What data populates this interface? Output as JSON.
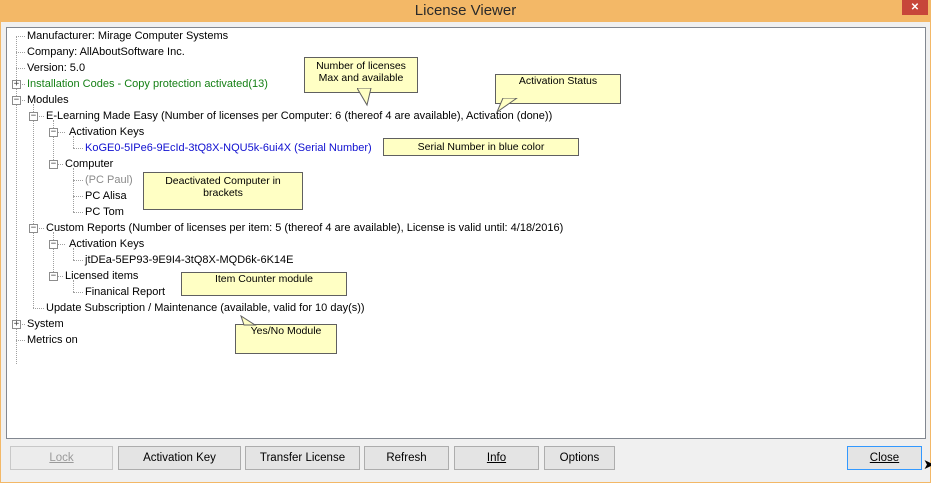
{
  "window": {
    "title": "License Viewer"
  },
  "tree": {
    "manufacturer": "Manufacturer: Mirage Computer Systems",
    "company": "Company: AllAboutSoftware Inc.",
    "version": "Version: 5.0",
    "installation_codes": "Installation Codes - Copy protection activated(13)",
    "modules": "Modules",
    "elearning": "E-Learning Made Easy (Number of licenses per Computer: 6 (thereof 4 are available), Activation (done))",
    "activation_keys_1": "Activation Keys",
    "serial_1": "KoGE0-5IPe6-9EcId-3tQ8X-NQU5k-6ui4X (Serial Number)",
    "computer": "Computer",
    "pc_paul": "(PC Paul)",
    "pc_alisa": "PC Alisa",
    "pc_tom": "PC Tom",
    "custom_reports": "Custom Reports (Number of licenses per item: 5 (thereof 4 are available), License is valid until: 4/18/2016)",
    "activation_keys_2": "Activation Keys",
    "serial_2": "jtDEa-5EP93-9E9I4-3tQ8X-MQD6k-6K14E",
    "licensed_items": "Licensed items",
    "financial_report": "Finanical Report",
    "update_subscription": "Update Subscription / Maintenance (available, valid for 10 day(s))",
    "system": "System",
    "metrics": "Metrics on"
  },
  "callouts": {
    "licenses_line1": "Number of licenses",
    "licenses_line2": "Max and available",
    "activation_status": "Activation Status",
    "serial_blue": "Serial Number in blue color",
    "deactivated_line1": "Deactivated Computer in",
    "deactivated_line2": "brackets",
    "item_counter": "Item Counter module",
    "yes_no": "Yes/No Module"
  },
  "buttons": {
    "lock": "Lock",
    "activation_key": "Activation Key",
    "transfer_license": "Transfer License",
    "refresh": "Refresh",
    "info": "Info",
    "options": "Options",
    "close": "Close"
  },
  "colors": {
    "title_bar": "#f3b867",
    "installation_codes": "#168016",
    "serial_number": "#1010d0",
    "deactivated": "#8a8a8a",
    "callout": "#ffffc4"
  },
  "icons": {
    "window_close": "close-icon",
    "expand": "plus-box-icon",
    "collapse": "minus-box-icon",
    "cursor": "mouse-pointer-icon"
  }
}
